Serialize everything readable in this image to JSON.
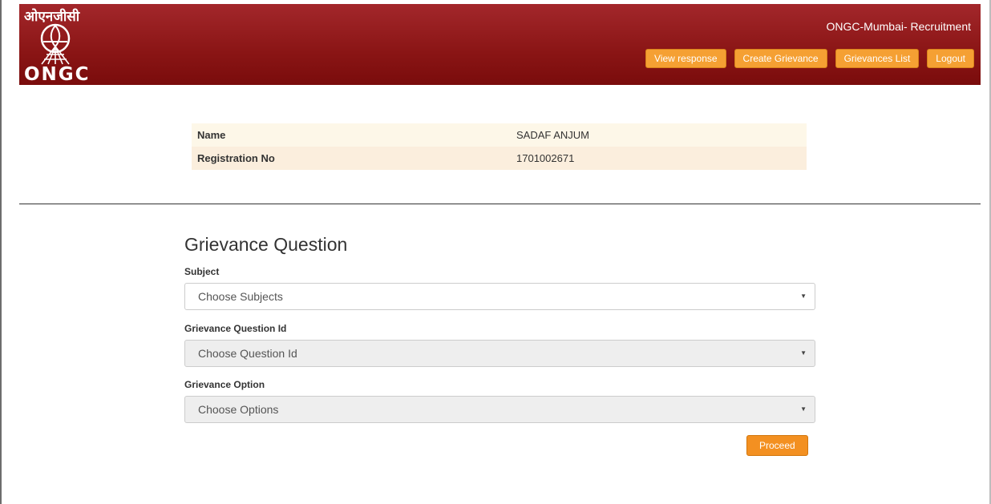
{
  "header": {
    "logo_hindi": "ओएनजीसी",
    "logo_text": "ONGC",
    "site_title": "ONGC-Mumbai- Recruitment",
    "nav": [
      {
        "label": "View response"
      },
      {
        "label": "Create Grievance"
      },
      {
        "label": "Grievances List"
      },
      {
        "label": "Logout"
      }
    ]
  },
  "candidate": {
    "rows": [
      {
        "label": "Name",
        "value": "SADAF ANJUM"
      },
      {
        "label": "Registration No",
        "value": "1701002671"
      }
    ]
  },
  "form": {
    "title": "Grievance Question",
    "subject": {
      "label": "Subject",
      "selected": "Choose Subjects",
      "disabled": false
    },
    "question_id": {
      "label": "Grievance Question Id",
      "selected": "Choose Question Id",
      "disabled": true
    },
    "option": {
      "label": "Grievance Option",
      "selected": "Choose Options",
      "disabled": true
    },
    "proceed_label": "Proceed"
  },
  "icons": {
    "logo": "ongc-emblem-icon",
    "dropdown": "chevron-down-icon"
  },
  "colors": {
    "header_bg": "#8a1515",
    "nav_button": "#f5a033",
    "proceed_button": "#f39021",
    "row_light": "#fdf7e8",
    "row_dark": "#fbeedd",
    "disabled_select": "#eeeeee"
  }
}
